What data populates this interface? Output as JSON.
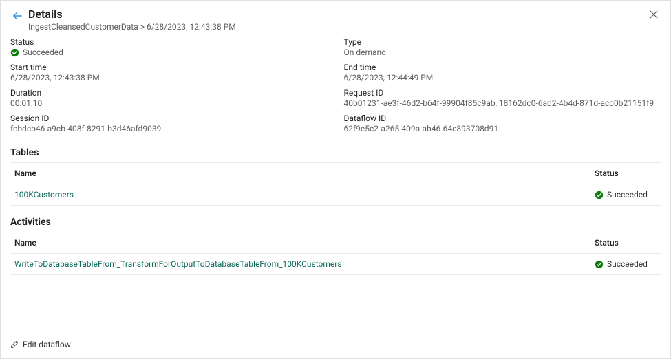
{
  "header": {
    "title": "Details",
    "breadcrumb": "IngestCleansedCustomerData > 6/28/2023, 12:43:38 PM"
  },
  "fields": {
    "status_label": "Status",
    "status_value": "Succeeded",
    "type_label": "Type",
    "type_value": "On demand",
    "start_label": "Start time",
    "start_value": "6/28/2023, 12:43:38 PM",
    "end_label": "End time",
    "end_value": "6/28/2023, 12:44:49 PM",
    "duration_label": "Duration",
    "duration_value": "00:01:10",
    "request_label": "Request ID",
    "request_value": "40b01231-ae3f-46d2-b64f-99904f85c9ab, 18162dc0-6ad2-4b4d-871d-acd0b21151f9",
    "session_label": "Session ID",
    "session_value": "fcbdcb46-a9cb-408f-8291-b3d46afd9039",
    "dataflow_label": "Dataflow ID",
    "dataflow_value": "62f9e5c2-a265-409a-ab46-64c893708d91"
  },
  "tables_section": {
    "title": "Tables",
    "name_header": "Name",
    "status_header": "Status",
    "rows": [
      {
        "name": "100KCustomers",
        "status": "Succeeded"
      }
    ]
  },
  "activities_section": {
    "title": "Activities",
    "name_header": "Name",
    "status_header": "Status",
    "rows": [
      {
        "name": "WriteToDatabaseTableFrom_TransformForOutputToDatabaseTableFrom_100KCustomers",
        "status": "Succeeded"
      }
    ]
  },
  "footer": {
    "edit_label": "Edit dataflow"
  }
}
